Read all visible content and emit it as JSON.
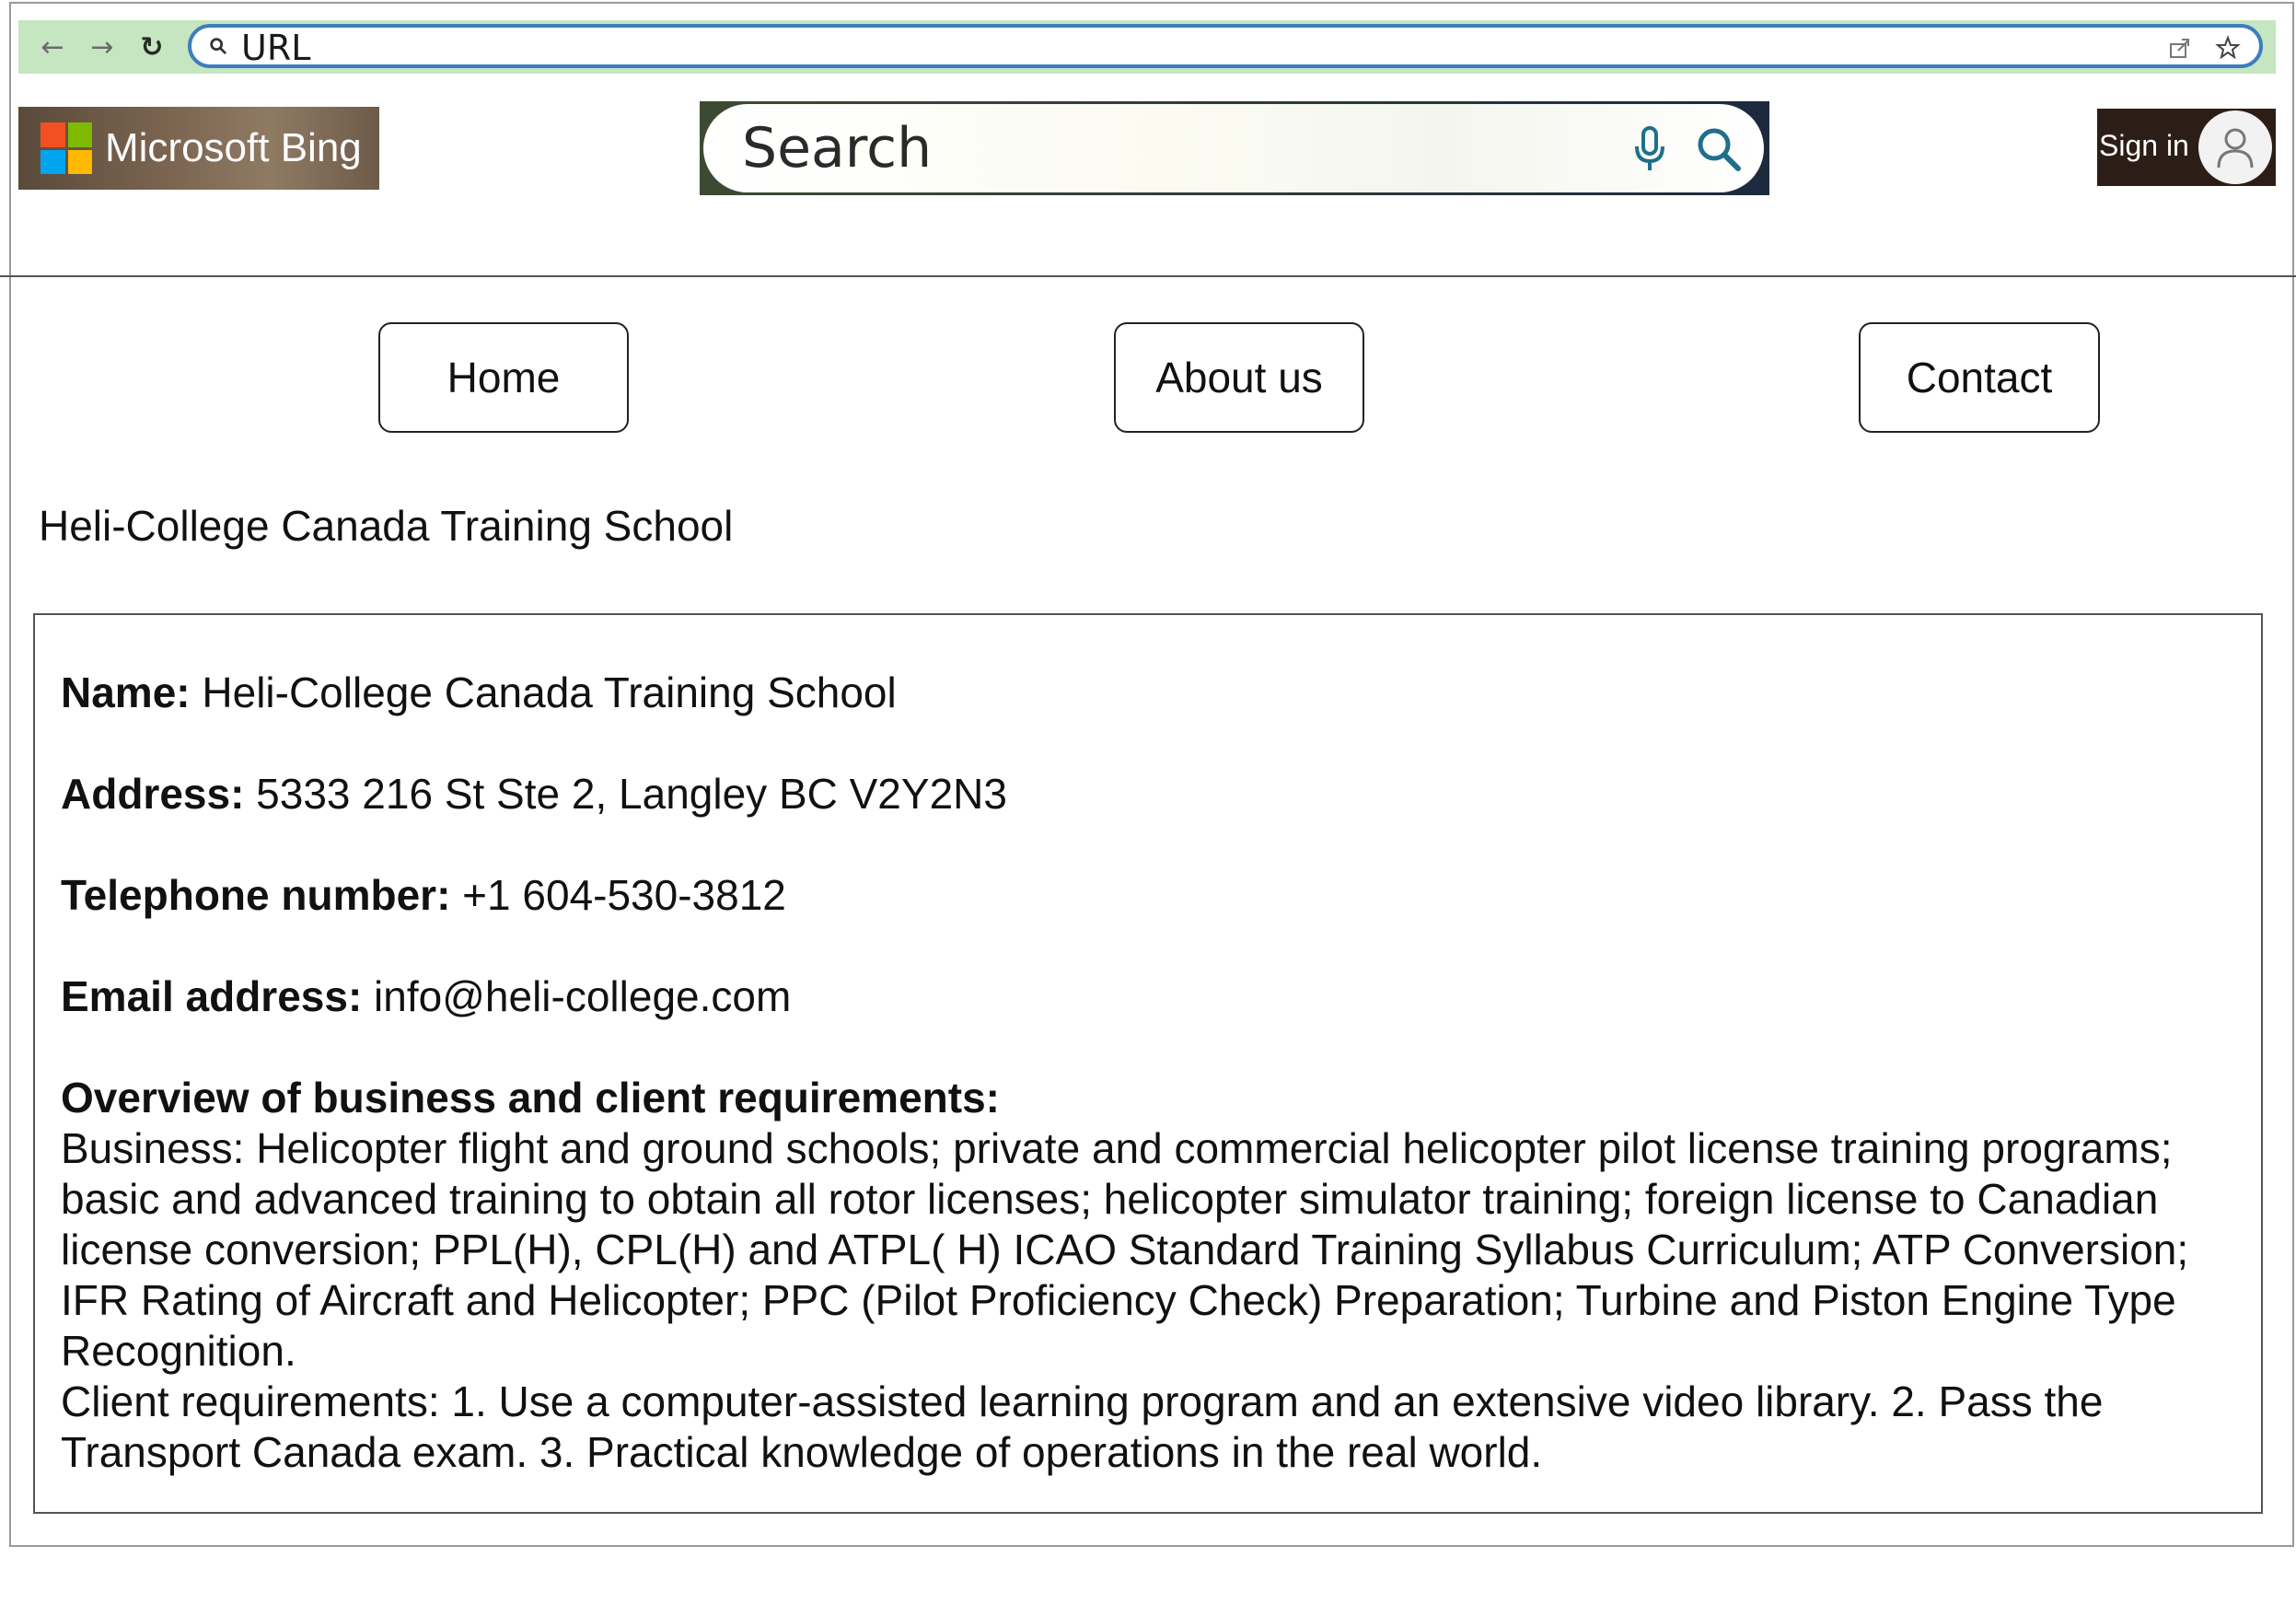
{
  "browser": {
    "url": "URL",
    "icons": {
      "back": "arrow-left-icon",
      "forward": "arrow-right-icon",
      "reload": "reload-icon",
      "search": "search-icon",
      "share": "share-icon",
      "bookmark": "star-icon"
    },
    "accent_color": "#3d7dbf",
    "strip_color": "#c5e6c0"
  },
  "bing": {
    "logo_text": "Microsoft Bing",
    "search_placeholder": "Search",
    "sign_in_label": "Sign in"
  },
  "nav": {
    "home": "Home",
    "about": "About us",
    "contact": "Contact"
  },
  "page": {
    "heading": "Heli-College Canada Training School"
  },
  "info": {
    "name_label": "Name:",
    "name_value": "Heli-College Canada Training School",
    "address_label": "Address:",
    "address_value": "5333 216 St Ste 2, Langley BC V2Y2N3",
    "phone_label": "Telephone number:",
    "phone_value": "+1 604-530-3812",
    "email_label": "Email address:",
    "email_value": "info@heli-college.com",
    "overview_title": "Overview of business and client requirements:",
    "business_text": "Business: Helicopter flight and ground schools; private and commercial helicopter pilot license training programs; basic and advanced training to obtain all rotor licenses; helicopter simulator training; foreign license to Canadian license conversion; PPL(H), CPL(H) and ATPL( H) ICAO Standard Training Syllabus Curriculum; ATP Conversion; IFR Rating of Aircraft and Helicopter; PPC (Pilot Proficiency Check) Preparation; Turbine and Piston Engine Type Recognition.",
    "client_text": "Client requirements: 1. Use a computer-assisted learning program and an extensive video library. 2. Pass the Transport Canada exam. 3. Practical knowledge of operations in the real world."
  }
}
